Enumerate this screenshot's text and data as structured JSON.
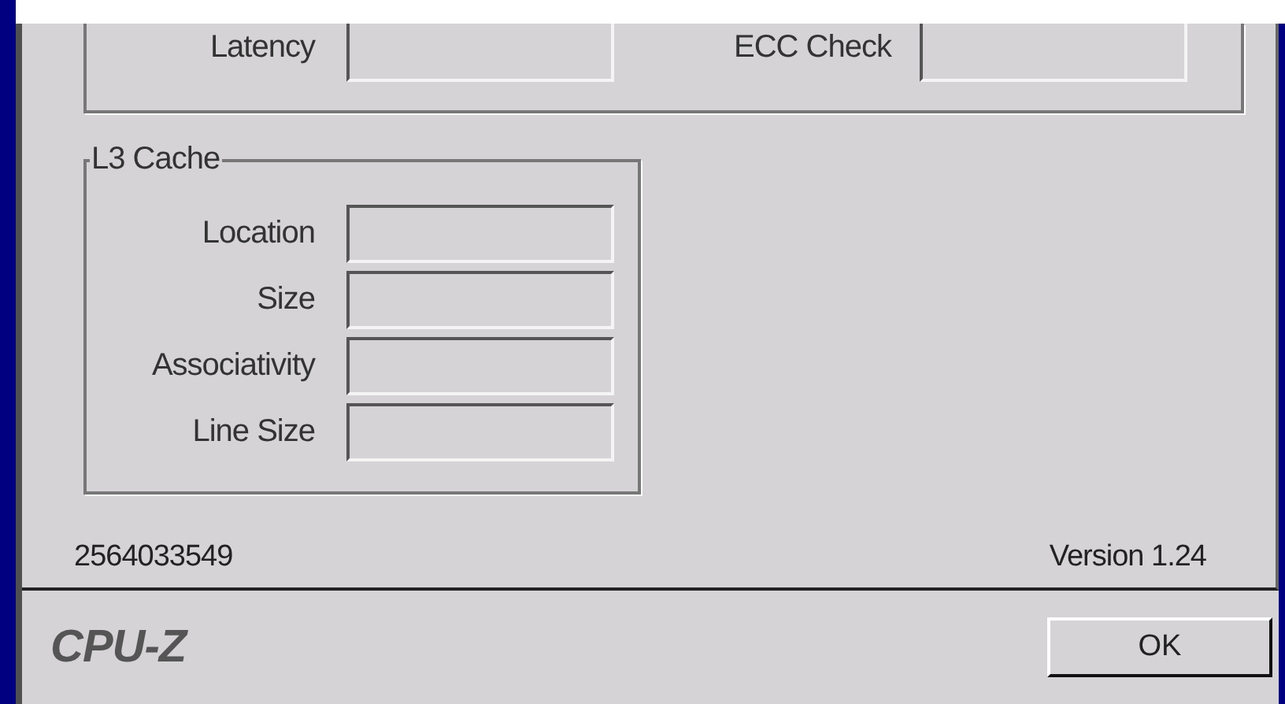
{
  "upper_group": {
    "fields": [
      {
        "label": "Latency"
      },
      {
        "label": "ECC Check"
      }
    ]
  },
  "l3_cache": {
    "title": "L3 Cache",
    "fields": [
      {
        "label": "Location"
      },
      {
        "label": "Size"
      },
      {
        "label": "Associativity"
      },
      {
        "label": "Line Size"
      }
    ]
  },
  "footer": {
    "serial": "2564033549",
    "version": "Version 1.24"
  },
  "brand": "CPU-Z",
  "buttons": [
    "OK"
  ]
}
